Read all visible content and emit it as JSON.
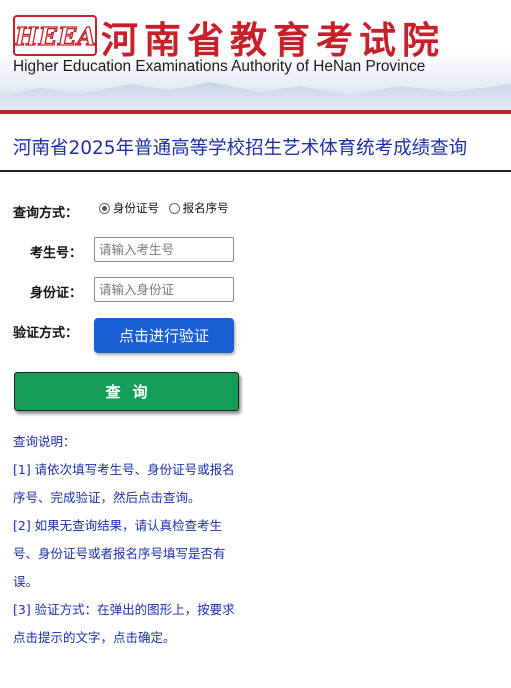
{
  "header": {
    "logo_text": "HEEA",
    "title_cn": "河南省教育考试院",
    "title_en": "Higher Education Examinations Authority of HeNan Province"
  },
  "page": {
    "heading": "河南省2025年普通高等学校招生艺术体育统考成绩查询"
  },
  "form": {
    "query_method_label": "查询方式：",
    "radio_options": [
      {
        "label": "身份证号",
        "checked": true
      },
      {
        "label": "报名序号",
        "checked": false
      }
    ],
    "exam_no_label": "考生号：",
    "exam_no_placeholder": "请输入考生号",
    "id_label": "身份证：",
    "id_placeholder": "请输入身份证",
    "verify_label": "验证方式：",
    "verify_button": "点击进行验证",
    "query_button": "查询"
  },
  "notes": {
    "title": "查询说明：",
    "items": [
      "[1] 请依次填写考生号、身份证号或报名序号、完成验证，然后点击查询。",
      "[2] 如果无查询结果，请认真检查考生号、身份证号或者报名序号填写是否有误。",
      "[3] 验证方式：在弹出的图形上，按要求点击提示的文字，点击确定。"
    ]
  },
  "colors": {
    "brand_red": "#c8202b",
    "heading_blue": "#1b2fa8",
    "verify_blue": "#1a5fd6",
    "query_green": "#149d57"
  }
}
